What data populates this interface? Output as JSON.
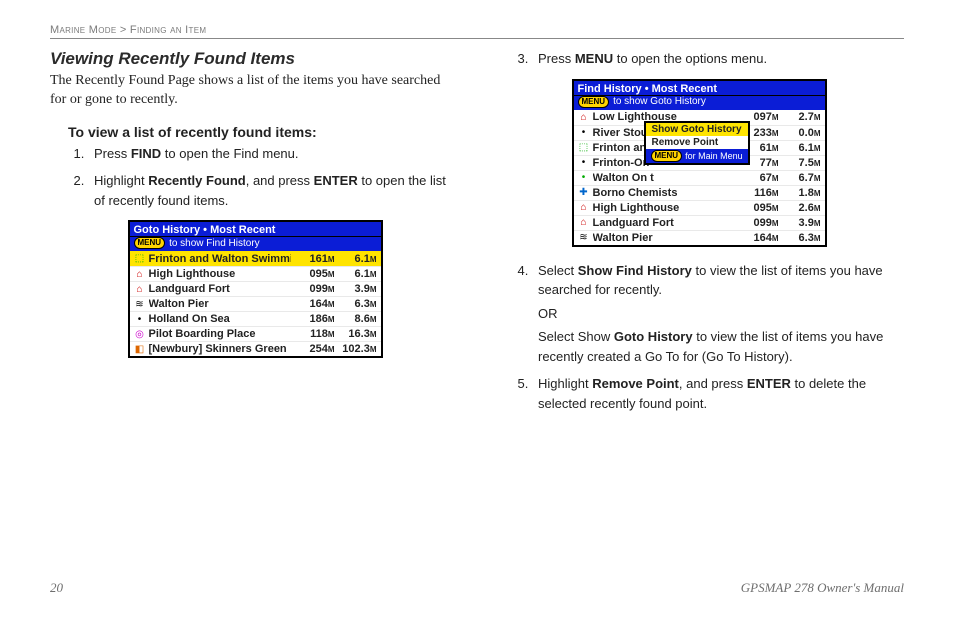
{
  "running_head": {
    "left": "Marine Mode",
    "sep": ">",
    "right": "Finding an Item"
  },
  "section_title": "Viewing Recently Found Items",
  "lead": "The Recently Found Page shows a list of the items you have searched for or gone to recently.",
  "task_title": "To view a list of recently found items:",
  "left_steps": {
    "s1_a": "Press ",
    "s1_b": "FIND",
    "s1_c": " to open the Find menu.",
    "s2_a": "Highlight ",
    "s2_b": "Recently Found",
    "s2_c": ", and press ",
    "s2_d": "ENTER",
    "s2_e": " to open the list of recently found items."
  },
  "right_steps": {
    "s3_a": "Press ",
    "s3_b": "MENU",
    "s3_c": " to open the options menu.",
    "s4_a": "Select ",
    "s4_b": "Show Find History",
    "s4_c": " to view the list of items you have searched for recently.",
    "s4_or": "OR",
    "s4_d": "Select Show ",
    "s4_e": "Goto History",
    "s4_f": "  to view the list of items you have recently created a Go To for (Go To History).",
    "s5_a": "Highlight ",
    "s5_b": "Remove Point",
    "s5_c": ", and press ",
    "s5_d": "ENTER",
    "s5_e": " to delete the selected recently found point."
  },
  "device1": {
    "title": "Goto History • Most Recent",
    "hint_badge": "MENU",
    "hint": "to show Find History",
    "rows": [
      {
        "icon": "⬚",
        "icls": "ico-grn",
        "name": "Frinton and Walton Swimmi",
        "dist": "161",
        "du": "M",
        "brg": "6.1",
        "bu": "M",
        "sel": true
      },
      {
        "icon": "⌂",
        "icls": "ico-red",
        "name": "High Lighthouse",
        "dist": "095",
        "du": "M",
        "brg": "6.1",
        "bu": "M"
      },
      {
        "icon": "⌂",
        "icls": "ico-red",
        "name": "Landguard Fort",
        "dist": "099",
        "du": "M",
        "brg": "3.9",
        "bu": "M"
      },
      {
        "icon": "≋",
        "icls": "ico-blk",
        "name": "Walton Pier",
        "dist": "164",
        "du": "M",
        "brg": "6.3",
        "bu": "M"
      },
      {
        "icon": "•",
        "icls": "ico-blk",
        "name": "Holland On Sea",
        "dist": "186",
        "du": "M",
        "brg": "8.6",
        "bu": "M"
      },
      {
        "icon": "◎",
        "icls": "ico-mag",
        "name": "Pilot Boarding Place",
        "dist": "118",
        "du": "M",
        "brg": "16.3",
        "bu": "M"
      },
      {
        "icon": "◧",
        "icls": "ico-ora",
        "name": "[Newbury] Skinners Green",
        "dist": "254",
        "du": "M",
        "brg": "102.3",
        "bu": "M"
      }
    ]
  },
  "device2": {
    "title": "Find History • Most Recent",
    "hint_badge": "MENU",
    "hint": "to show Goto History",
    "popup": {
      "line1": "Show Goto History",
      "line2": "Remove Point",
      "hint_badge": "MENU",
      "hint": "for Main Menu"
    },
    "rows": [
      {
        "icon": "⌂",
        "icls": "ico-red",
        "name": "Low Lighthouse",
        "dist": "097",
        "du": "M",
        "brg": "2.7",
        "bu": "M"
      },
      {
        "icon": "•",
        "icls": "ico-blk",
        "name": "River Stour",
        "dist": "233",
        "du": "M",
        "brg": "0.0",
        "bu": "M"
      },
      {
        "icon": "⬚",
        "icls": "ico-grn",
        "name": "Frinton an",
        "dist": "61",
        "du": "M",
        "brg": "6.1",
        "bu": "M"
      },
      {
        "icon": "•",
        "icls": "ico-blk",
        "name": "Frinton-On",
        "dist": "77",
        "du": "M",
        "brg": "7.5",
        "bu": "M"
      },
      {
        "icon": "•",
        "icls": "ico-grn",
        "name": "Walton On t",
        "dist": "67",
        "du": "M",
        "brg": "6.7",
        "bu": "M"
      },
      {
        "icon": "✚",
        "icls": "ico-blu",
        "name": "Borno Chemists",
        "dist": "116",
        "du": "M",
        "brg": "1.8",
        "bu": "M"
      },
      {
        "icon": "⌂",
        "icls": "ico-red",
        "name": "High Lighthouse",
        "dist": "095",
        "du": "M",
        "brg": "2.6",
        "bu": "M"
      },
      {
        "icon": "⌂",
        "icls": "ico-red",
        "name": "Landguard Fort",
        "dist": "099",
        "du": "M",
        "brg": "3.9",
        "bu": "M"
      },
      {
        "icon": "≋",
        "icls": "ico-blk",
        "name": "Walton Pier",
        "dist": "164",
        "du": "M",
        "brg": "6.3",
        "bu": "M"
      }
    ]
  },
  "footer": {
    "page": "20",
    "manual": "GPSMAP 278 Owner's Manual"
  }
}
